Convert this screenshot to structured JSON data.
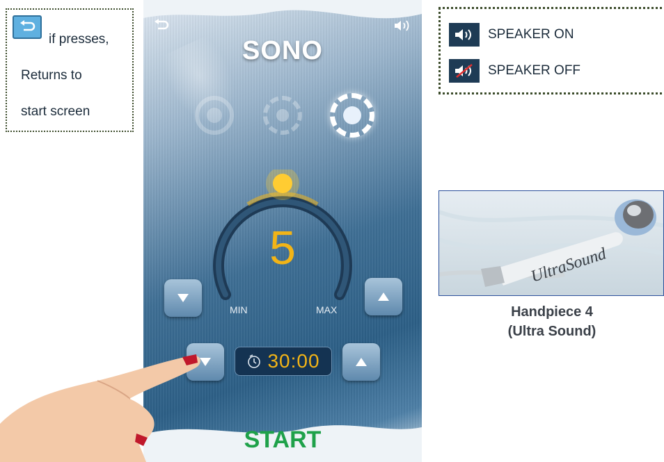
{
  "note_left": {
    "line1": "if presses,",
    "line2": "Returns to",
    "line3": "start screen",
    "icon": "return-icon"
  },
  "note_right": {
    "speaker_on": "SPEAKER ON",
    "speaker_off": "SPEAKER OFF"
  },
  "device": {
    "title": "SONO",
    "level": "5",
    "min_label": "MIN",
    "max_label": "MAX",
    "timer": "30:00",
    "start_label": "START",
    "level_fraction": 0.5
  },
  "photo": {
    "engraved": "UltraSound"
  },
  "caption": {
    "line1": "Handpiece 4",
    "line2": "(Ultra Sound)"
  },
  "colors": {
    "accent_orange": "#f2b417",
    "start_green": "#1fa14a",
    "panel_dark": "#1e3b55"
  }
}
